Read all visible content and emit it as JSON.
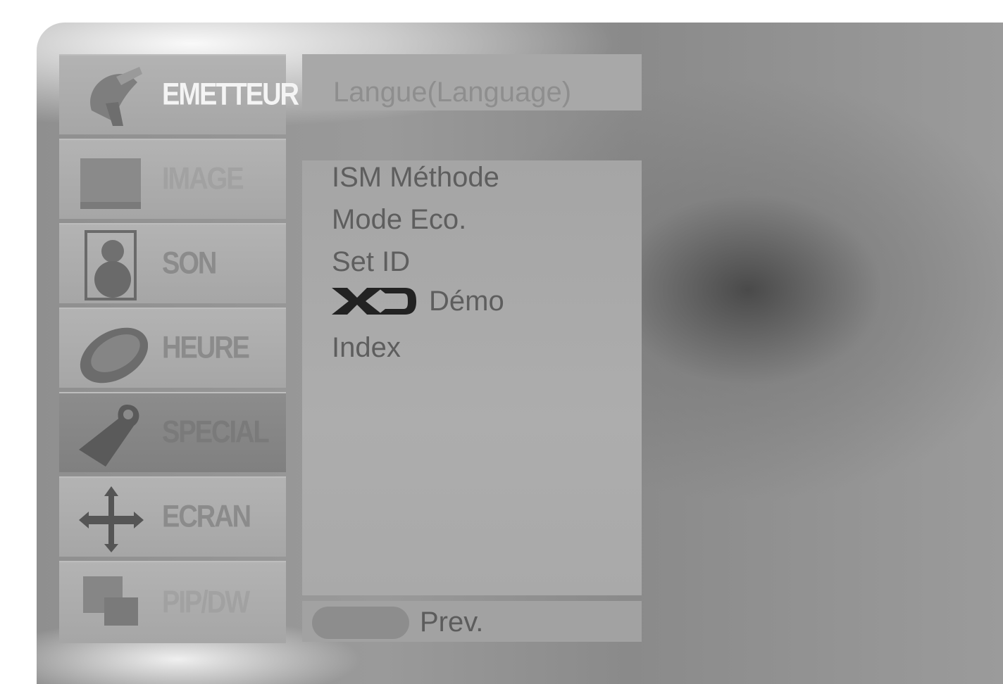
{
  "menu": [
    {
      "label": "EMETTEUR",
      "icon": "satellite-dish-icon"
    },
    {
      "label": "IMAGE",
      "icon": "monitor-icon"
    },
    {
      "label": "SON",
      "icon": "speaker-icon"
    },
    {
      "label": "HEURE",
      "icon": "clock-icon"
    },
    {
      "label": "SPECIAL",
      "icon": "tag-key-icon"
    },
    {
      "label": "ECRAN",
      "icon": "move-arrows-icon"
    },
    {
      "label": "PIP/DW",
      "icon": "pip-windows-icon"
    }
  ],
  "active_menu": "SPECIAL",
  "submenu": {
    "top_item": "Langue(Language)",
    "items": [
      "ISM Méthode",
      "Mode Eco.",
      "Set ID",
      "Démo",
      "Index"
    ],
    "xd_logo_text": "XD"
  },
  "footer": {
    "prev_label": "Prev."
  },
  "colors": {
    "panel": "#a8a8a8",
    "active": "#808080",
    "text": "#5e5e5e"
  }
}
